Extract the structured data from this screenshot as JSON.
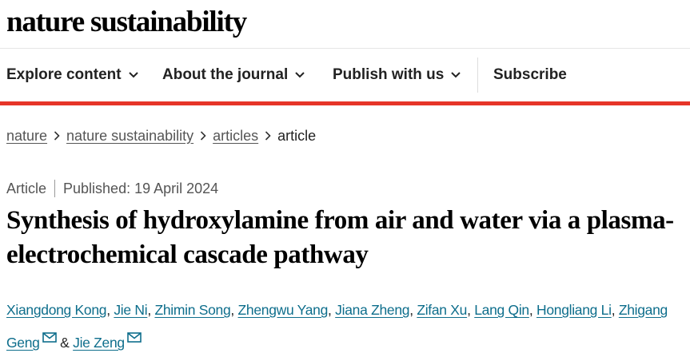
{
  "brand": {
    "name": "nature sustainability"
  },
  "nav": {
    "explore": "Explore content",
    "about": "About the journal",
    "publish": "Publish with us",
    "subscribe": "Subscribe"
  },
  "breadcrumb": {
    "items": [
      "nature",
      "nature sustainability",
      "articles"
    ],
    "current": "article"
  },
  "article": {
    "type": "Article",
    "published": "Published: 19 April 2024",
    "title": "Synthesis of hydroxylamine from air and water via a plasma-electrochemical cascade pathway",
    "authors": [
      "Xiangdong Kong",
      "Jie Ni",
      "Zhimin Song",
      "Zhengwu Yang",
      "Jiana Zheng",
      "Zifan Xu",
      "Lang Qin",
      "Hongliang Li",
      "Zhigang Geng",
      "Jie Zeng"
    ],
    "author_sep": ", ",
    "author_and": " & "
  },
  "icons": {
    "chevron": "chevron-down-icon",
    "crumb_separator": "chevron-right-icon",
    "mail": "mail-icon"
  },
  "colors": {
    "accent_red": "#e63528",
    "author_link": "#0e6e8c",
    "text": "#222222",
    "muted": "#555555"
  }
}
